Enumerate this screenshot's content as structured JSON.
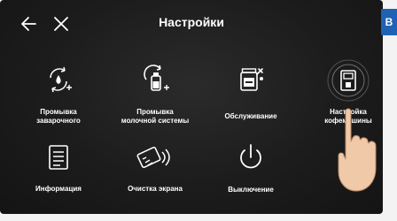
{
  "header": {
    "title": "Настройки",
    "back_icon": "arrow-left-icon",
    "close_icon": "close-icon"
  },
  "side_tab": {
    "label": "В",
    "color": "#1f62b5"
  },
  "tiles": [
    {
      "label": "Промывка\nзаварочного",
      "icon": "brew-rinse-icon"
    },
    {
      "label": "Промывка\nмолочной системы",
      "icon": "milk-rinse-icon"
    },
    {
      "label": "Обслуживание",
      "icon": "maintenance-icon"
    },
    {
      "label": "Настройка\nкофемашины",
      "icon": "coffee-machine-icon"
    },
    {
      "label": "Информация",
      "icon": "information-icon"
    },
    {
      "label": "Очистка экрана",
      "icon": "screen-clean-icon"
    },
    {
      "label": "Выключение",
      "icon": "power-icon"
    }
  ]
}
